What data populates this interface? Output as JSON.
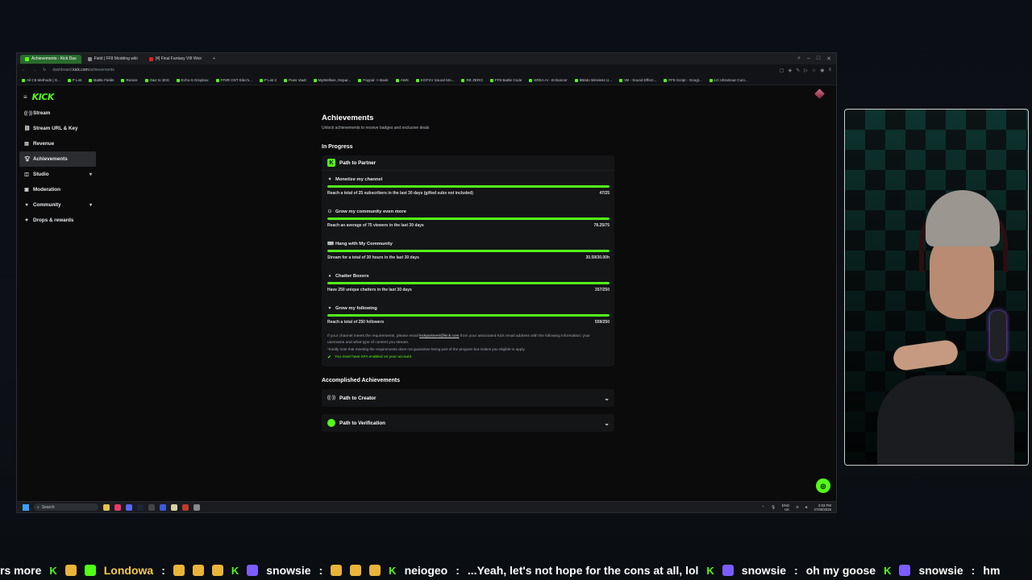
{
  "browser": {
    "tabs": [
      {
        "label": "Achievements - Kick Das",
        "active": true,
        "icon": "kick-icon"
      },
      {
        "label": "Field | FF8 Modding wiki",
        "active": false,
        "icon": "wiki-icon"
      },
      {
        "label": "[4] Final Fantasy VIII Weir",
        "active": false,
        "icon": "youtube-icon"
      }
    ],
    "url_prefix": "dashboard.",
    "url_domain": "kick.com",
    "url_path": "/achievements",
    "bookmarks": [
      "All C8 Methods | S...",
      "P List",
      "Battle Fields",
      "Resize",
      "O&J to 3DS",
      "Echo-S Dropbox",
      "FF8R OST Eiko's...",
      "P List 2",
      "Pass Vault",
      "MyWelfare, Depar...",
      "Paypal -> Bank",
      "AWS",
      "KOFXV Sound Mo...",
      "RE ZERO",
      "FF8 Battle Code",
      "KREA AI - Enhancer",
      "8Bitdo Wireless U...",
      "VB - Sound Effect...",
      "FF8 Script - Googl...",
      "LG UltraGear Curv..."
    ]
  },
  "sidebar": {
    "logo": "KICK",
    "items": [
      {
        "label": "Stream",
        "icon": "broadcast-icon",
        "active": false,
        "expandable": false
      },
      {
        "label": "Stream URL & Key",
        "icon": "link-icon",
        "active": false,
        "expandable": false
      },
      {
        "label": "Revenue",
        "icon": "revenue-icon",
        "active": false,
        "expandable": false
      },
      {
        "label": "Achievements",
        "icon": "trophy-icon",
        "active": true,
        "expandable": false
      },
      {
        "label": "Studio",
        "icon": "studio-icon",
        "active": false,
        "expandable": true
      },
      {
        "label": "Moderation",
        "icon": "shield-icon",
        "active": false,
        "expandable": false
      },
      {
        "label": "Community",
        "icon": "community-icon",
        "active": false,
        "expandable": true
      },
      {
        "label": "Drops & rewards",
        "icon": "gift-icon",
        "active": false,
        "expandable": false
      }
    ]
  },
  "main": {
    "title": "Achievements",
    "subtitle": "Unlock achievements to receive badges and exclusive deals",
    "in_progress_title": "In Progress",
    "partner_card": {
      "title": "Path to Partner",
      "goals": [
        {
          "title": "Monetize my channel",
          "icon": "sparkle-icon",
          "requirement": "Reach a total of 25 subscribers in the last 30 days (gifted subs not included)",
          "progress": "47/25",
          "fraction": 1.0
        },
        {
          "title": "Grow my community even more",
          "icon": "viewers-icon",
          "requirement": "Reach an average of 75 viewers in the last 30 days",
          "progress": "78.25/75",
          "fraction": 1.0
        },
        {
          "title": "Hang with My Community",
          "icon": "gamepad-icon",
          "requirement": "Stream for a total of 30 hours in the last 30 days",
          "progress": "30.59/30.00h",
          "fraction": 1.0
        },
        {
          "title": "Chatter Boxers",
          "icon": "chat-icon",
          "requirement": "Have 250 unique chatters in the last 30 days",
          "progress": "357/250",
          "fraction": 1.0
        },
        {
          "title": "Grow my following",
          "icon": "heart-icon",
          "requirement": "Reach a total of 250 followers",
          "progress": "559/250",
          "fraction": 1.0
        }
      ],
      "note_before_link": "If your channel meets the requirements, please email ",
      "note_link": "kickpartners@kick.com",
      "note_after_link": " from your associated Kick email address with the following information: your username and what type of content you stream.",
      "note2": "*Kindly note that meeting the requirements does not guarantee being part of the program but makes you eligible to apply.",
      "twofa": "You must have 2FA enabled on your account"
    },
    "accomplished_title": "Accomplished Achievements",
    "accomplished": [
      {
        "title": "Path to Creator",
        "icon": "broadcast-icon"
      },
      {
        "title": "Path to Verification",
        "icon": "verified-icon"
      }
    ]
  },
  "taskbar": {
    "search_placeholder": "Search",
    "lang_top": "ENG",
    "lang_bottom": "UK",
    "time": "2:03 PM",
    "date": "27/05/2026"
  },
  "ticker": [
    {
      "type": "text",
      "text": "rs more"
    },
    {
      "type": "user",
      "name": "Londowa",
      "message": ""
    },
    {
      "type": "user",
      "name": "snowsie",
      "message": ""
    },
    {
      "type": "user",
      "name": "neiogeo",
      "message": "...Yeah, let's not hope for the cons at all, lol"
    },
    {
      "type": "user",
      "name": "snowsie",
      "message": "oh my goose"
    },
    {
      "type": "user",
      "name": "snowsie",
      "message": "hm"
    }
  ],
  "colors": {
    "accent": "#53fc18",
    "background": "#0b0b0c",
    "card": "#141517"
  }
}
